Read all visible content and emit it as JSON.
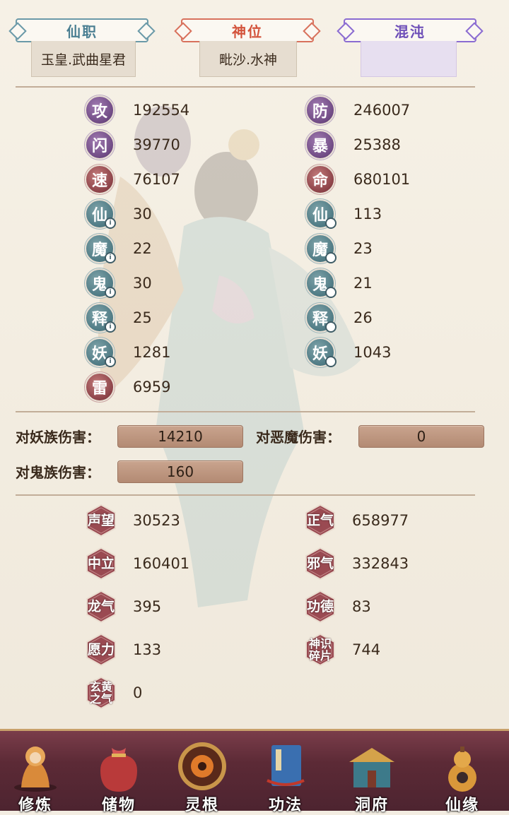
{
  "tabs": [
    {
      "label": "仙职",
      "value": "玉皇.武曲星君"
    },
    {
      "label": "神位",
      "value": "毗沙.水神"
    },
    {
      "label": "混沌",
      "value": ""
    }
  ],
  "stats_left": [
    {
      "char": "攻",
      "value": "192554",
      "style": "purple",
      "mark": ""
    },
    {
      "char": "闪",
      "value": "39770",
      "style": "purple",
      "mark": ""
    },
    {
      "char": "速",
      "value": "76107",
      "style": "red",
      "mark": ""
    },
    {
      "char": "仙",
      "value": "30",
      "style": "teal",
      "mark": "i"
    },
    {
      "char": "魔",
      "value": "22",
      "style": "teal",
      "mark": "i"
    },
    {
      "char": "鬼",
      "value": "30",
      "style": "teal",
      "mark": "i"
    },
    {
      "char": "释",
      "value": "25",
      "style": "teal",
      "mark": "i"
    },
    {
      "char": "妖",
      "value": "1281",
      "style": "teal",
      "mark": "i"
    },
    {
      "char": "雷",
      "value": "6959",
      "style": "red",
      "mark": ""
    }
  ],
  "stats_right": [
    {
      "char": "防",
      "value": "246007",
      "style": "purple",
      "mark": ""
    },
    {
      "char": "暴",
      "value": "25388",
      "style": "purple",
      "mark": ""
    },
    {
      "char": "命",
      "value": "680101",
      "style": "red",
      "mark": ""
    },
    {
      "char": "仙",
      "value": "113",
      "style": "teal",
      "mark": "o"
    },
    {
      "char": "魔",
      "value": "23",
      "style": "teal",
      "mark": "o"
    },
    {
      "char": "鬼",
      "value": "21",
      "style": "teal",
      "mark": "o"
    },
    {
      "char": "释",
      "value": "26",
      "style": "teal",
      "mark": "o"
    },
    {
      "char": "妖",
      "value": "1043",
      "style": "teal",
      "mark": "o"
    }
  ],
  "damage": [
    {
      "label": "对妖族伤害：",
      "value": "14210"
    },
    {
      "label": "对恶魔伤害：",
      "value": "0"
    },
    {
      "label": "对鬼族伤害：",
      "value": "160"
    }
  ],
  "reputation_left": [
    {
      "label": "声望",
      "value": "30523"
    },
    {
      "label": "中立",
      "value": "160401"
    },
    {
      "label": "龙气",
      "value": "395"
    },
    {
      "label": "愿力",
      "value": "133"
    },
    {
      "label": "玄黄\n之气",
      "value": "0"
    }
  ],
  "reputation_right": [
    {
      "label": "正气",
      "value": "658977"
    },
    {
      "label": "邪气",
      "value": "332843"
    },
    {
      "label": "功德",
      "value": "83"
    },
    {
      "label": "神识\n碎片",
      "value": "744"
    }
  ],
  "nav": [
    {
      "label": "修炼",
      "icon": "cultivate-icon"
    },
    {
      "label": "储物",
      "icon": "storage-bag-icon"
    },
    {
      "label": "灵根",
      "icon": "spirit-root-icon"
    },
    {
      "label": "功法",
      "icon": "scripture-book-icon"
    },
    {
      "label": "洞府",
      "icon": "cave-palace-icon"
    },
    {
      "label": "仙缘",
      "icon": "gourd-icon"
    }
  ]
}
